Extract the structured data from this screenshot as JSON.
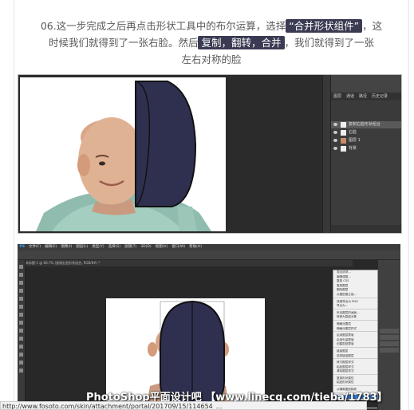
{
  "instruction": {
    "line1_a": "06.这一步完成之后再点击形状工具中的布尔运算，选择",
    "tag1": "“合并形状组件”",
    "line1_b": "，这",
    "line2_a": "时候我们就得到了一张右脸。然后",
    "tag2": "复制，翻转，合并",
    "line2_b": "，我们就得到了一张",
    "line3": "左右对称的脸"
  },
  "shot1": {
    "panel_tabs": [
      "图层",
      "通道",
      "路径",
      "历史记录",
      "属性",
      "样式"
    ],
    "layers": [
      "复制右脸形状组合",
      "右脸",
      "图层 1",
      "背景"
    ],
    "selected_layer_index": 0
  },
  "shot2": {
    "menubar": [
      "PS",
      "文件(F)",
      "编辑(E)",
      "图像(I)",
      "图层(L)",
      "类型(Y)",
      "选择(S)",
      "滤镜(T)",
      "3D(D)",
      "视图(V)",
      "窗口(W)",
      "帮助(H)"
    ],
    "doctab": "未标题-1 @ 66.7% (复制右脸形状组合, RGB/8#) *",
    "context_menu": [
      "混合选项...",
      "编辑调整...",
      "复制 CSS",
      "复制图层",
      "删除图层",
      "从图层建立组...",
      "",
      "快速导出为 PNG",
      "导出为...",
      "",
      "来自图层的画板...",
      "转换为智能对象",
      "",
      "栅格化图层",
      "栅格化图层样式",
      "",
      "启用图层蒙版",
      "启用矢量蒙版",
      "创建剪贴蒙版",
      "",
      "链接图层",
      "选择链接图层",
      "",
      "拷贝图层样式",
      "粘贴图层样式",
      "清除图层样式",
      "",
      "复制形状属性",
      "粘贴形状属性",
      "",
      "从隔离图层释放",
      "",
      "合并形状",
      "合并可见图层",
      "拼合图像",
      "",
      "无颜色",
      "红色",
      "橙色",
      "黄色"
    ],
    "highlight_index": 32
  },
  "watermark": "PhotoShop平面设计吧 【www.linecg.com/tieba/1783】",
  "url": "http://www.fosoto.com/skin/attachment/portal/201709/15/114654_...",
  "colors": {
    "tag_bg": "#3a3b52",
    "shape_fill": "#2f3050",
    "ps_dark": "#2b2b2b",
    "menu_highlight": "#3478d6"
  }
}
